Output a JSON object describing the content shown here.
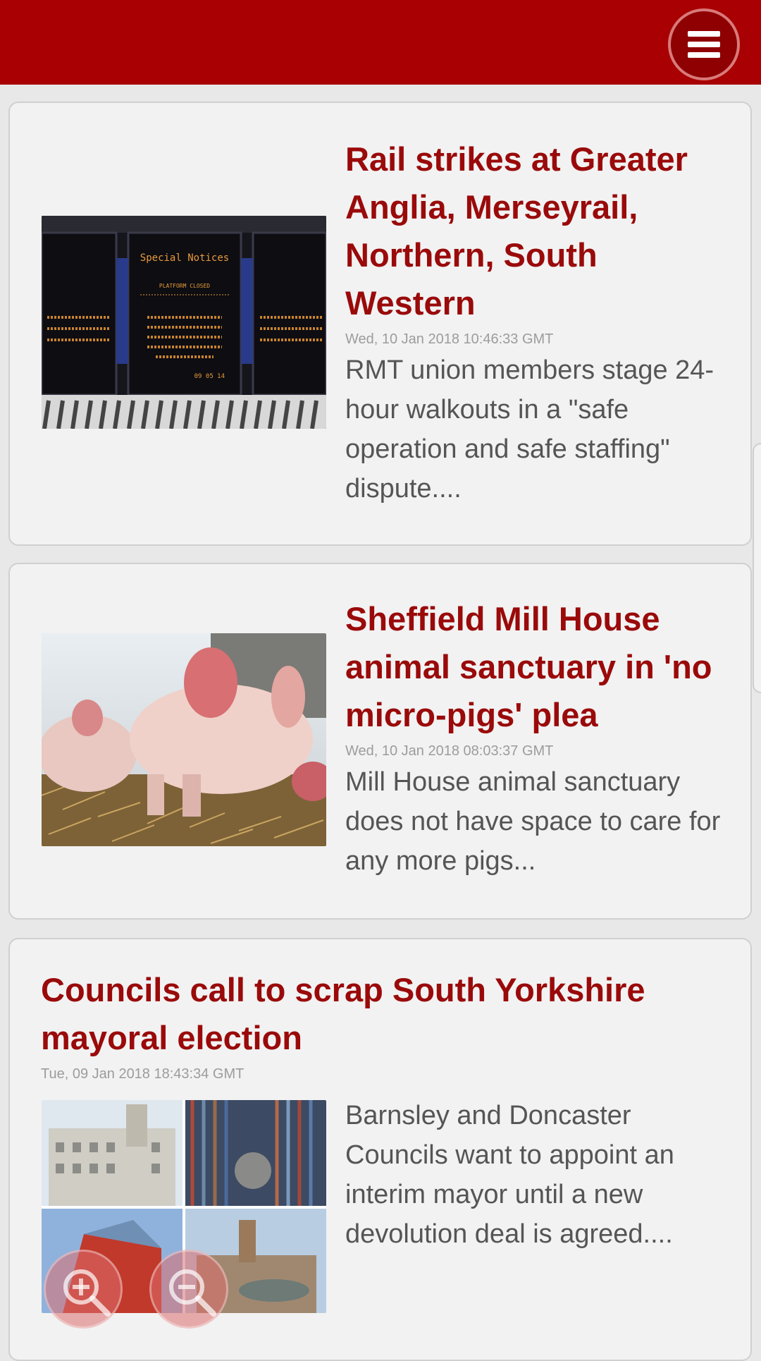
{
  "header": {
    "menu_icon": "hamburger-menu-icon",
    "color": "#a80003"
  },
  "articles": [
    {
      "title": "Rail strikes at Greater Anglia, Merseyrail, Northern, South Western",
      "date": "Wed, 10 Jan 2018 10:46:33 GMT",
      "summary": "RMT union members stage 24-hour walkouts in a \"safe operation and safe staffing\" dispute....",
      "image_text": "Special Notices",
      "image_text_2": "PLATFORM CLOSED",
      "image_text_3": "This platform is closed. Please refer to the main departure boards on the concourse for service information.",
      "image_text_4": "09 05 14"
    },
    {
      "title": "Sheffield Mill House animal sanctuary in 'no micro-pigs' plea",
      "date": "Wed, 10 Jan 2018 08:03:37 GMT",
      "summary": "Mill House animal sanctuary does not have space to care for any more pigs..."
    },
    {
      "title": "Councils call to scrap South Yorkshire mayoral election",
      "date": "Tue, 09 Jan 2018 18:43:34 GMT",
      "summary": "Barnsley and Doncaster Councils want to appoint an interim mayor until a new devolution deal is agreed...."
    }
  ],
  "zoom": {
    "in_icon": "zoom-in-icon",
    "out_icon": "zoom-out-icon"
  },
  "colors": {
    "title": "#9a0a0a",
    "date": "#9c9c9c",
    "summary": "#555555",
    "card": "#f2f2f2"
  }
}
